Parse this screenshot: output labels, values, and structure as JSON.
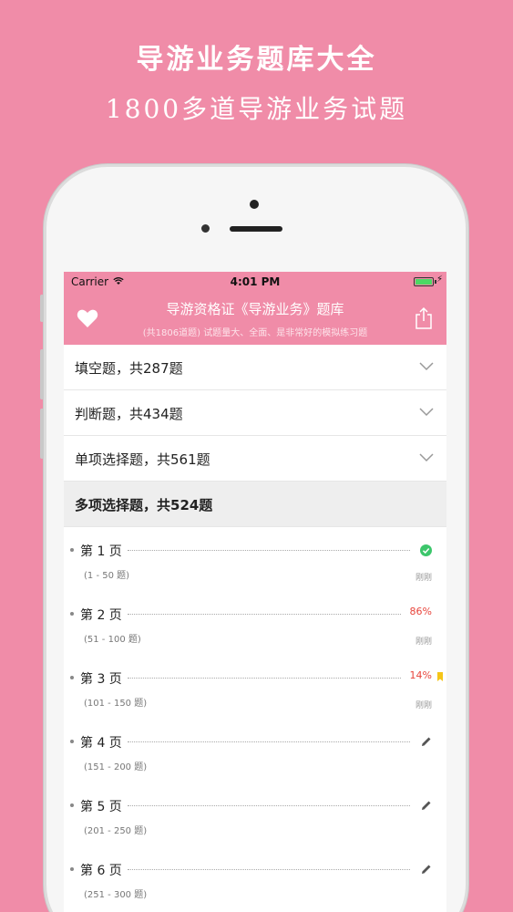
{
  "promo": {
    "title": "导游业务题库大全",
    "subtitle": "1800多道导游业务试题"
  },
  "statusbar": {
    "carrier": "Carrier",
    "time": "4:01 PM"
  },
  "navbar": {
    "title": "导游资格证《导游业务》题库",
    "subtitle": "(共1806道题) 试题量大、全面、是非常好的模拟练习题",
    "left_icon": "heart-icon",
    "right_icon": "share-icon"
  },
  "sections": [
    {
      "label": "填空题，共287题",
      "expanded": false
    },
    {
      "label": "判断题，共434题",
      "expanded": false
    },
    {
      "label": "单项选择题，共561题",
      "expanded": false
    },
    {
      "label": "多项选择题，共524题",
      "expanded": true
    }
  ],
  "pages": [
    {
      "name": "第 1 页",
      "range": "(1 - 50 题)",
      "status": "check-icon",
      "percent": "",
      "time": "刚刚"
    },
    {
      "name": "第 2 页",
      "range": "(51 - 100 题)",
      "status": "percent",
      "percent": "86%",
      "time": "刚刚"
    },
    {
      "name": "第 3 页",
      "range": "(101 - 150 题)",
      "status": "percent-bookmark",
      "percent": "14%",
      "time": "刚刚"
    },
    {
      "name": "第 4 页",
      "range": "(151 - 200 题)",
      "status": "pencil-icon",
      "percent": "",
      "time": ""
    },
    {
      "name": "第 5 页",
      "range": "(201 - 250 题)",
      "status": "pencil-icon",
      "percent": "",
      "time": ""
    },
    {
      "name": "第 6 页",
      "range": "(251 - 300 题)",
      "status": "pencil-icon",
      "percent": "",
      "time": ""
    }
  ],
  "colors": {
    "brand": "#f08ca8",
    "check": "#3cc66b",
    "percent": "#e8453c",
    "bookmark": "#f5c518"
  }
}
